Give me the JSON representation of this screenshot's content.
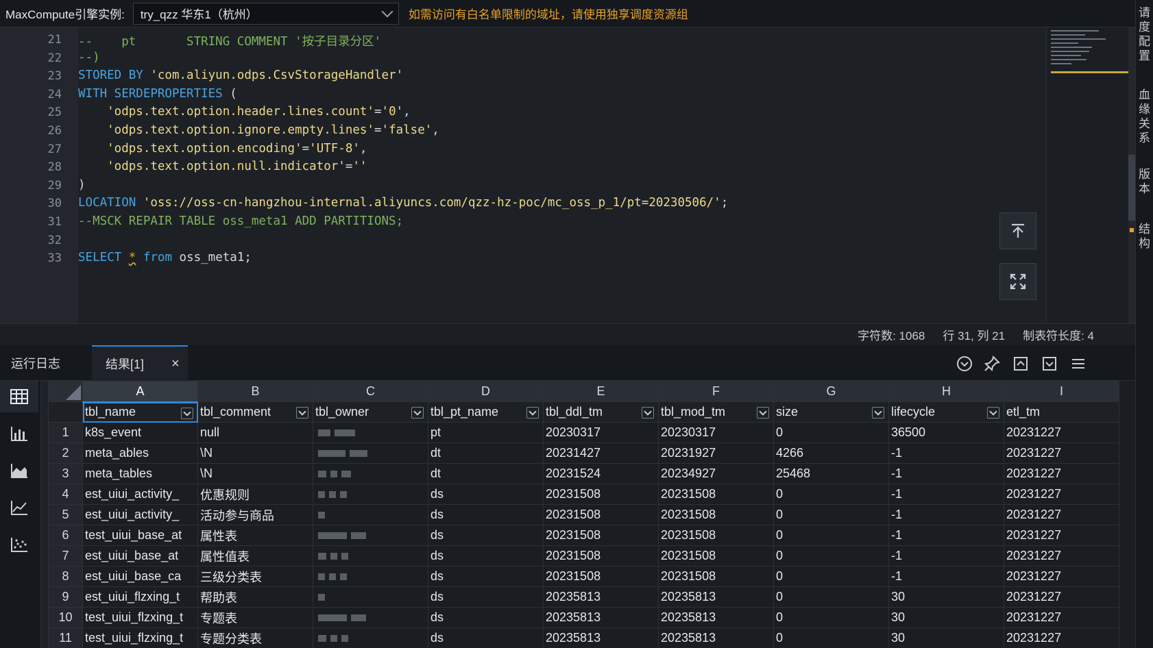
{
  "topbar": {
    "instance_label": "MaxCompute引擎实例:",
    "instance_value": "try_qzz 华东1（杭州）",
    "warning": "如需访问有白名单限制的域址，请使用独享调度资源组"
  },
  "right_panel_text": [
    "请",
    "度",
    "配",
    "置",
    "血",
    "缘",
    "关",
    "系",
    "版",
    "本",
    "结",
    "构"
  ],
  "editor": {
    "lines": [
      {
        "n": "21",
        "tokens": [
          {
            "t": "--    pt       STRING COMMENT '按子目录分区'",
            "c": "cm"
          }
        ]
      },
      {
        "n": "22",
        "tokens": [
          {
            "t": "--)",
            "c": "cm"
          }
        ]
      },
      {
        "n": "23",
        "tokens": [
          {
            "t": "STORED BY ",
            "c": "kw"
          },
          {
            "t": "'com.aliyun.odps.CsvStorageHandler'",
            "c": "str"
          }
        ]
      },
      {
        "n": "24",
        "tokens": [
          {
            "t": "WITH SERDEPROPERTIES ",
            "c": "kw"
          },
          {
            "t": "(",
            "c": "op"
          }
        ]
      },
      {
        "n": "25",
        "tokens": [
          {
            "t": "    'odps.text.option.header.lines.count'",
            "c": "str"
          },
          {
            "t": "=",
            "c": "op"
          },
          {
            "t": "'0'",
            "c": "str"
          },
          {
            "t": ",",
            "c": "op"
          }
        ]
      },
      {
        "n": "26",
        "tokens": [
          {
            "t": "    'odps.text.option.ignore.empty.lines'",
            "c": "str"
          },
          {
            "t": "=",
            "c": "op"
          },
          {
            "t": "'false'",
            "c": "str"
          },
          {
            "t": ",",
            "c": "op"
          }
        ]
      },
      {
        "n": "27",
        "tokens": [
          {
            "t": "    'odps.text.option.encoding'",
            "c": "str"
          },
          {
            "t": "=",
            "c": "op"
          },
          {
            "t": "'UTF-8'",
            "c": "str"
          },
          {
            "t": ",",
            "c": "op"
          }
        ]
      },
      {
        "n": "28",
        "tokens": [
          {
            "t": "    'odps.text.option.null.indicator'",
            "c": "str"
          },
          {
            "t": "=",
            "c": "op"
          },
          {
            "t": "''",
            "c": "str"
          }
        ]
      },
      {
        "n": "29",
        "tokens": [
          {
            "t": ")",
            "c": "op"
          }
        ]
      },
      {
        "n": "30",
        "tokens": [
          {
            "t": "LOCATION ",
            "c": "kw"
          },
          {
            "t": "'oss://oss-cn-hangzhou-internal.aliyuncs.com/qzz-hz-poc/mc_oss_p_1/pt=20230506/'",
            "c": "str"
          },
          {
            "t": ";",
            "c": "op"
          }
        ]
      },
      {
        "n": "31",
        "tokens": [
          {
            "t": "--MSCK REPAIR TABLE oss_meta1 ADD PARTITIONS;",
            "c": "cm"
          }
        ]
      },
      {
        "n": "32",
        "tokens": []
      },
      {
        "n": "33",
        "tokens": [
          {
            "t": "SELECT ",
            "c": "kw"
          },
          {
            "t": "*",
            "c": "squig"
          },
          {
            "t": " from ",
            "c": "kw"
          },
          {
            "t": "oss_meta1;",
            "c": "op"
          }
        ]
      }
    ],
    "first_line_partial": "21"
  },
  "status": {
    "char_count": "字符数: 1068",
    "cursor": "行 31, 列 21",
    "tab_size": "制表符长度: 4"
  },
  "tabs": {
    "log": "运行日志",
    "result": "结果[1]",
    "close": "×"
  },
  "grid": {
    "col_letters": [
      "A",
      "B",
      "C",
      "D",
      "E",
      "F",
      "G",
      "H",
      "I"
    ],
    "fields": [
      "tbl_name",
      "tbl_comment",
      "tbl_owner",
      "tbl_pt_name",
      "tbl_ddl_tm",
      "tbl_mod_tm",
      "size",
      "lifecycle",
      "etl_tm"
    ],
    "rows": [
      {
        "n": "1",
        "cells": [
          "k8s_event",
          "null",
          "",
          "pt",
          "20230317",
          "20230317",
          "0",
          "36500",
          "20231227"
        ]
      },
      {
        "n": "2",
        "cells": [
          "meta_ables",
          "\\N",
          "",
          "dt",
          "20231427",
          "20231927",
          "4266",
          "-1",
          "20231227"
        ]
      },
      {
        "n": "3",
        "cells": [
          "meta_tables",
          "\\N",
          "",
          "dt",
          "20231524",
          "20234927",
          "25468",
          "-1",
          "20231227"
        ]
      },
      {
        "n": "4",
        "cells": [
          "est_uiui_activity_",
          "优惠规则",
          "",
          "ds",
          "20231508",
          "20231508",
          "0",
          "-1",
          "20231227"
        ]
      },
      {
        "n": "5",
        "cells": [
          "est_uiui_activity_",
          "活动参与商品",
          "",
          "ds",
          "20231508",
          "20231508",
          "0",
          "-1",
          "20231227"
        ]
      },
      {
        "n": "6",
        "cells": [
          "test_uiui_base_at",
          "属性表",
          "",
          "ds",
          "20231508",
          "20231508",
          "0",
          "-1",
          "20231227"
        ]
      },
      {
        "n": "7",
        "cells": [
          "est_uiui_base_at",
          "属性值表",
          "",
          "ds",
          "20231508",
          "20231508",
          "0",
          "-1",
          "20231227"
        ]
      },
      {
        "n": "8",
        "cells": [
          "est_uiui_base_ca",
          "三级分类表",
          "",
          "ds",
          "20231508",
          "20231508",
          "0",
          "-1",
          "20231227"
        ]
      },
      {
        "n": "9",
        "cells": [
          "est_uiui_flzxing_t",
          "帮助表",
          "",
          "ds",
          "20235813",
          "20235813",
          "0",
          "30",
          "20231227"
        ]
      },
      {
        "n": "10",
        "cells": [
          "test_uiui_flzxing_t",
          "专题表",
          "",
          "ds",
          "20235813",
          "20235813",
          "0",
          "30",
          "20231227"
        ]
      },
      {
        "n": "11",
        "cells": [
          "test_uiui_flzxing_t",
          "专题分类表",
          "",
          "ds",
          "20235813",
          "20235813",
          "0",
          "30",
          "20231227"
        ]
      }
    ]
  },
  "colors": {
    "accent": "#2c8ae0",
    "warning": "#e8a228",
    "keyword": "#4aa3e0",
    "string": "#efd98a",
    "comment": "#7fb25b"
  }
}
